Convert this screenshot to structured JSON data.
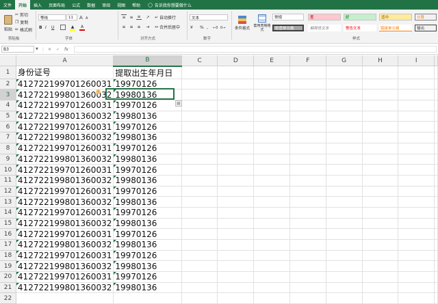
{
  "tabs": [
    "文件",
    "开始",
    "插入",
    "页面布局",
    "公式",
    "数据",
    "审阅",
    "视图",
    "帮助"
  ],
  "active_tab": "开始",
  "tell_me": "告诉我你想要做什么",
  "clipboard": {
    "paste": "粘贴",
    "cut": "剪切",
    "copy": "复制",
    "format_painter": "格式刷",
    "group": "剪贴板"
  },
  "font": {
    "name": "等线",
    "size": "11",
    "group": "字体",
    "bold": "B",
    "italic": "I",
    "underline": "U",
    "grow": "A",
    "shrink": "A"
  },
  "alignment": {
    "wrap": "自动换行",
    "merge": "合并后居中",
    "group": "对齐方式"
  },
  "number": {
    "format": "文本",
    "percent": "%",
    "comma": ",",
    "group": "数字"
  },
  "styles": {
    "conditional": "条件格式",
    "table": "套用表格格式",
    "normal": "常规",
    "bad": "差",
    "good": "好",
    "neutral": "适中",
    "calc": "计算",
    "check": "检查单元格",
    "explain": "解释性文本",
    "warning": "警告文本",
    "linked": "链接单元格",
    "output": "输出",
    "group": "样式"
  },
  "formula_bar": {
    "name_box": "B3",
    "fx": "fx",
    "content": ""
  },
  "columns": [
    "A",
    "B",
    "C",
    "D",
    "E",
    "F",
    "G",
    "H",
    "I"
  ],
  "selected_col": "B",
  "selected_row": 3,
  "rows": [
    {
      "n": "1",
      "a": "身份证号",
      "b": "提取出生年月日"
    },
    {
      "n": "2",
      "a": "412722199701260031",
      "b": "19970126"
    },
    {
      "n": "3",
      "a": "412722199801360032",
      "b": "19980136"
    },
    {
      "n": "4",
      "a": "412722199701260031",
      "b": "19970126"
    },
    {
      "n": "5",
      "a": "412722199801360032",
      "b": "19980136"
    },
    {
      "n": "6",
      "a": "412722199701260031",
      "b": "19970126"
    },
    {
      "n": "7",
      "a": "412722199801360032",
      "b": "19980136"
    },
    {
      "n": "8",
      "a": "412722199701260031",
      "b": "19970126"
    },
    {
      "n": "9",
      "a": "412722199801360032",
      "b": "19980136"
    },
    {
      "n": "10",
      "a": "412722199701260031",
      "b": "19970126"
    },
    {
      "n": "11",
      "a": "412722199801360032",
      "b": "19980136"
    },
    {
      "n": "12",
      "a": "412722199701260031",
      "b": "19970126"
    },
    {
      "n": "13",
      "a": "412722199801360032",
      "b": "19980136"
    },
    {
      "n": "14",
      "a": "412722199701260031",
      "b": "19970126"
    },
    {
      "n": "15",
      "a": "412722199801360032",
      "b": "19980136"
    },
    {
      "n": "16",
      "a": "412722199701260031",
      "b": "19970126"
    },
    {
      "n": "17",
      "a": "412722199801360032",
      "b": "19980136"
    },
    {
      "n": "18",
      "a": "412722199701260031",
      "b": "19970126"
    },
    {
      "n": "19",
      "a": "412722199801360032",
      "b": "19980136"
    },
    {
      "n": "20",
      "a": "412722199701260031",
      "b": "19970126"
    },
    {
      "n": "21",
      "a": "412722199801360032",
      "b": "19980136"
    },
    {
      "n": "22",
      "a": "",
      "b": ""
    }
  ],
  "colors": {
    "brand": "#217346",
    "bad_bg": "#ffc7ce",
    "good_bg": "#c6efce",
    "neutral_bg": "#ffeb9c",
    "calc_bg": "#f2f2f2",
    "check_bg": "#a5a5a5"
  }
}
